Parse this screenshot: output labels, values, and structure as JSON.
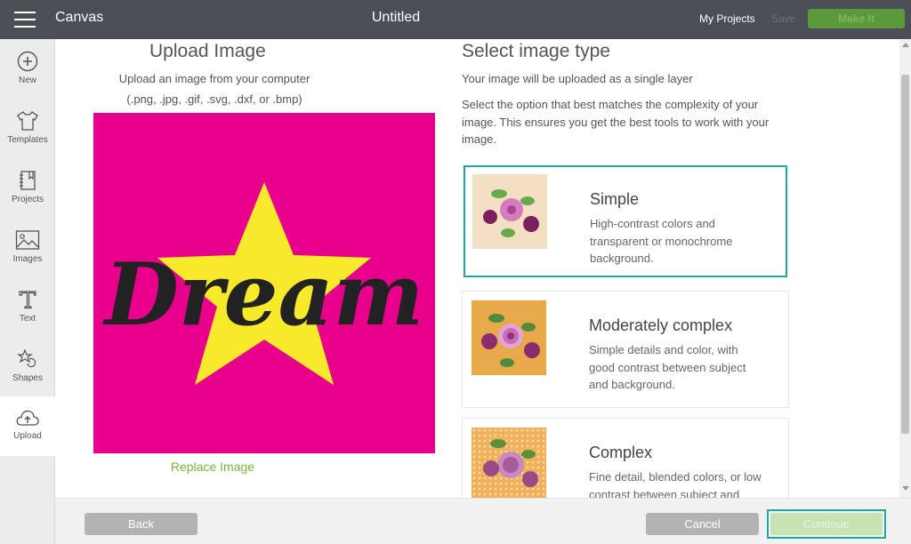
{
  "topbar": {
    "app_title": "Canvas",
    "doc_title": "Untitled",
    "my_projects": "My Projects",
    "save": "Save",
    "make_it": "Make It"
  },
  "sidebar": {
    "items": [
      {
        "label": "New",
        "icon": "plus-circle-icon"
      },
      {
        "label": "Templates",
        "icon": "tshirt-icon"
      },
      {
        "label": "Projects",
        "icon": "notebook-icon"
      },
      {
        "label": "Images",
        "icon": "image-icon"
      },
      {
        "label": "Text",
        "icon": "text-t-icon"
      },
      {
        "label": "Shapes",
        "icon": "shapes-icon"
      },
      {
        "label": "Upload",
        "icon": "cloud-upload-icon"
      }
    ],
    "active": "Upload"
  },
  "upload": {
    "title": "Upload Image",
    "subtitle": "Upload an image from your computer",
    "formats": "(.png, .jpg, .gif, .svg, .dxf, or .bmp)",
    "preview_text": "Dream",
    "replace": "Replace Image"
  },
  "image_type": {
    "title": "Select image type",
    "subtitle": "Your image will be uploaded as a single layer",
    "instructions": "Select the option that best matches the complexity of your image. This ensures you get the best tools to work with your image.",
    "options": [
      {
        "title": "Simple",
        "description": "High-contrast colors and transparent or monochrome background.",
        "selected": true
      },
      {
        "title": "Moderately complex",
        "description": "Simple details and color, with good contrast between subject and background.",
        "selected": false
      },
      {
        "title": "Complex",
        "description": "Fine detail, blended colors, or low contrast between subject and",
        "selected": false
      }
    ]
  },
  "footer": {
    "back": "Back",
    "cancel": "Cancel",
    "continue": "Continue"
  },
  "colors": {
    "topbar": "#4a4f55",
    "accent_teal": "#1ea99f",
    "make_it_green": "#5b9a3b",
    "replace_green": "#7ab33f",
    "preview_pink": "#e8008c",
    "star_yellow": "#f7ea2b"
  }
}
